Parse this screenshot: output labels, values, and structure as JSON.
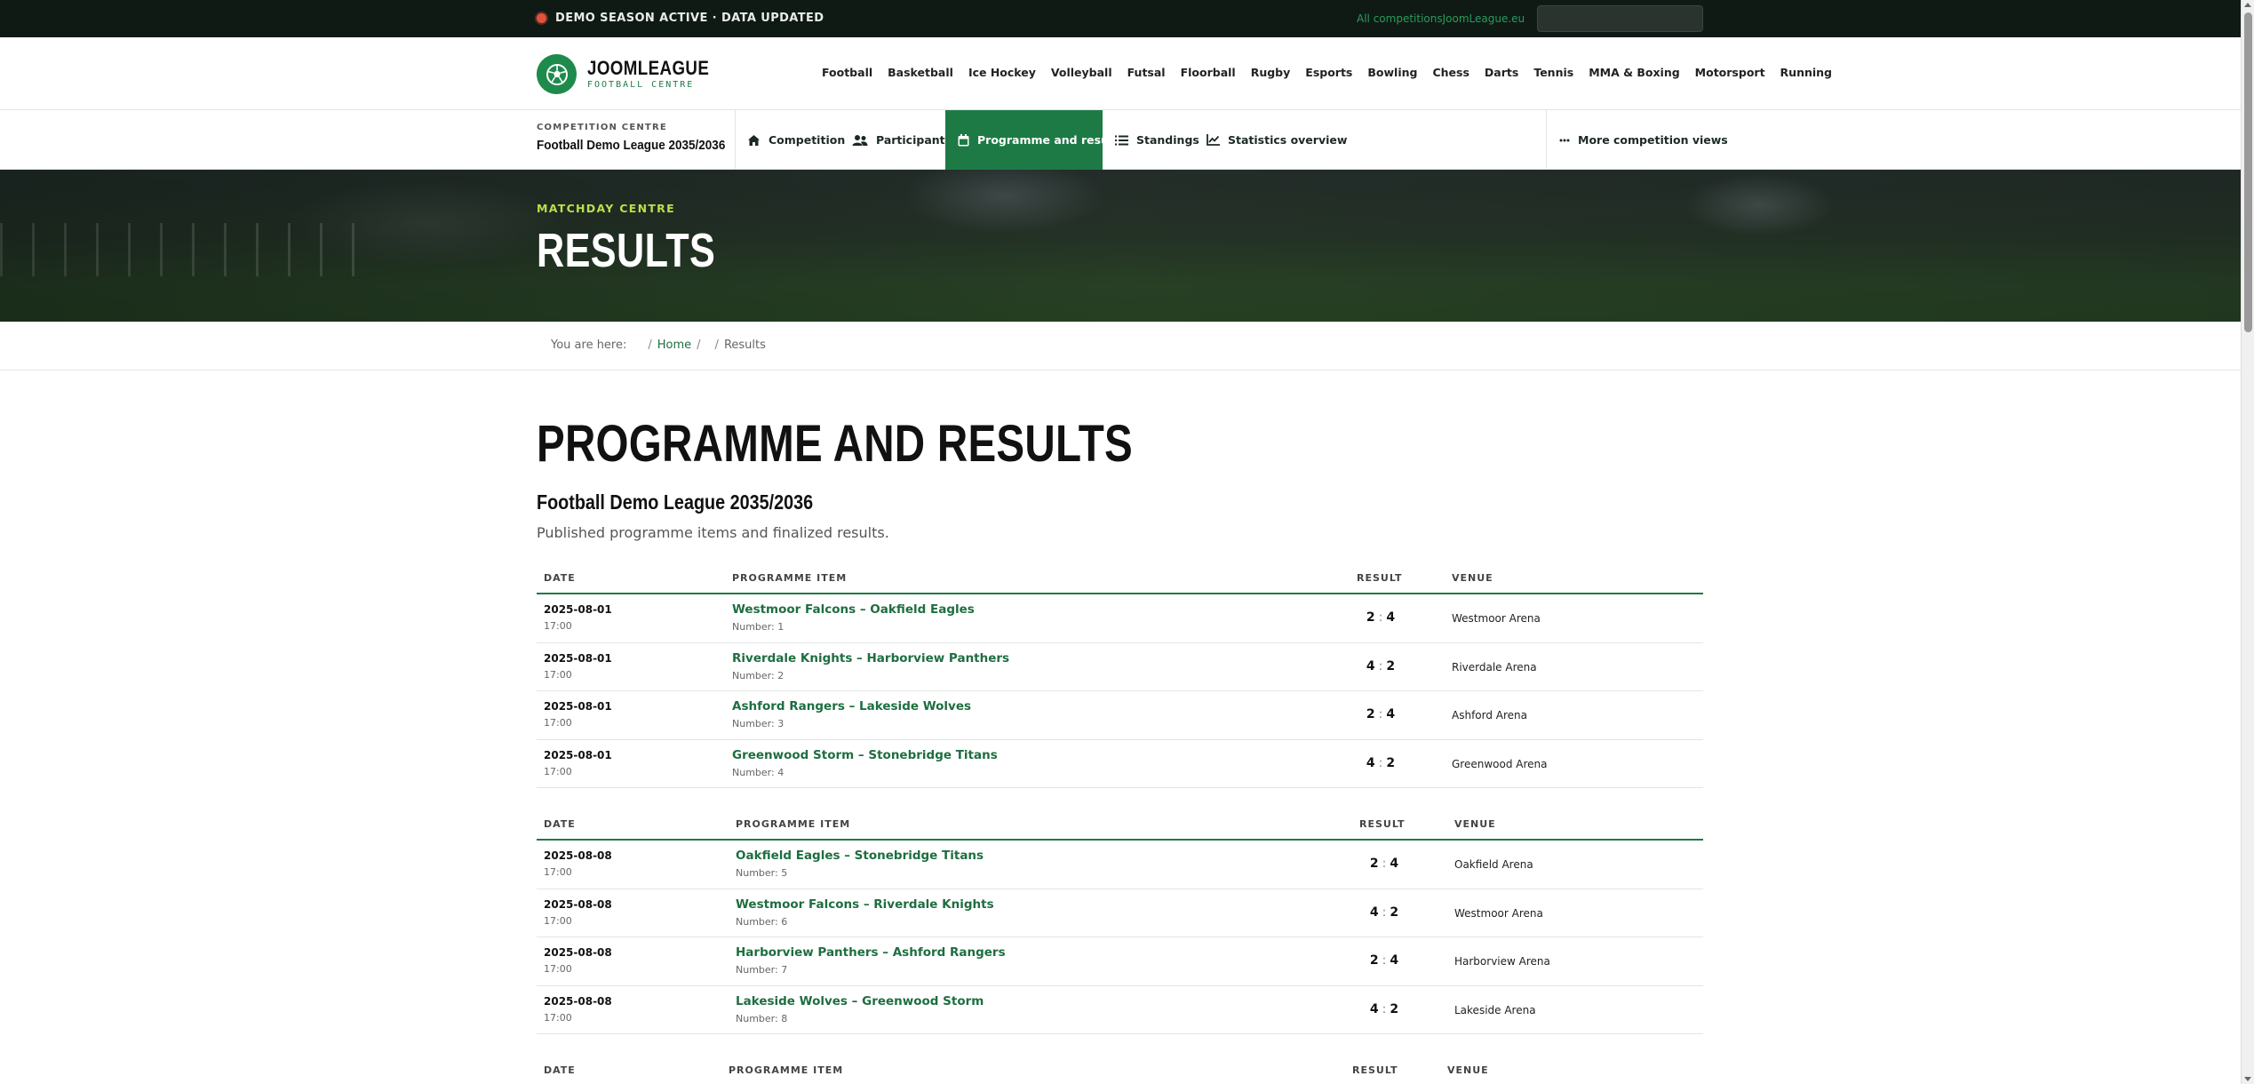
{
  "topbar": {
    "status": "DEMO SEASON ACTIVE · DATA UPDATED",
    "competitions_link": "All competitions",
    "competitions_site": "JoomLeague.eu",
    "status_color": "#e2523a"
  },
  "brand": {
    "name": "JOOMLEAGUE",
    "subtitle": "FOOTBALL CENTRE",
    "accent": "#1e7a45",
    "logo_icon": "soccer-ball-icon"
  },
  "sports": [
    "Football",
    "Basketball",
    "Ice Hockey",
    "Volleyball",
    "Futsal",
    "Floorball",
    "Rugby",
    "Esports",
    "Bowling",
    "Chess",
    "Darts",
    "Tennis",
    "MMA & Boxing",
    "Motorsport",
    "Running"
  ],
  "subnav": {
    "label": "COMPETITION CENTRE",
    "name": "Football Demo League 2035/2036",
    "tabs": [
      {
        "label": "Competition",
        "icon": "home-icon"
      },
      {
        "label": "Participants",
        "icon": "users-icon"
      },
      {
        "label": "Programme and results",
        "icon": "calendar-icon",
        "active": true
      },
      {
        "label": "Standings",
        "icon": "list-icon"
      },
      {
        "label": "Statistics overview",
        "icon": "chart-icon"
      }
    ],
    "more": "More competition views"
  },
  "hero": {
    "kicker": "MATCHDAY CENTRE",
    "title": "RESULTS"
  },
  "breadcrumb": {
    "prefix": "You are here:",
    "home": "Home",
    "current": "Results"
  },
  "main": {
    "title": "PROGRAMME AND RESULTS",
    "league": "Football Demo League 2035/2036",
    "lead": "Published programme items and finalized results."
  },
  "table_headers": {
    "date": "DATE",
    "item": "PROGRAMME ITEM",
    "result": "RESULT",
    "venue": "VENUE"
  },
  "matchdays": [
    {
      "rows": [
        {
          "date": "2025-08-01",
          "time": "17:00",
          "match": "Westmoor Falcons – Oakfield Eagles",
          "number": "Number: 1",
          "home": "2",
          "away": "4",
          "venue": "Westmoor Arena"
        },
        {
          "date": "2025-08-01",
          "time": "17:00",
          "match": "Riverdale Knights – Harborview Panthers",
          "number": "Number: 2",
          "home": "4",
          "away": "2",
          "venue": "Riverdale Arena"
        },
        {
          "date": "2025-08-01",
          "time": "17:00",
          "match": "Ashford Rangers – Lakeside Wolves",
          "number": "Number: 3",
          "home": "2",
          "away": "4",
          "venue": "Ashford Arena"
        },
        {
          "date": "2025-08-01",
          "time": "17:00",
          "match": "Greenwood Storm – Stonebridge Titans",
          "number": "Number: 4",
          "home": "4",
          "away": "2",
          "venue": "Greenwood Arena"
        }
      ]
    },
    {
      "rows": [
        {
          "date": "2025-08-08",
          "time": "17:00",
          "match": "Oakfield Eagles – Stonebridge Titans",
          "number": "Number: 5",
          "home": "2",
          "away": "4",
          "venue": "Oakfield Arena"
        },
        {
          "date": "2025-08-08",
          "time": "17:00",
          "match": "Westmoor Falcons – Riverdale Knights",
          "number": "Number: 6",
          "home": "4",
          "away": "2",
          "venue": "Westmoor Arena"
        },
        {
          "date": "2025-08-08",
          "time": "17:00",
          "match": "Harborview Panthers – Ashford Rangers",
          "number": "Number: 7",
          "home": "2",
          "away": "4",
          "venue": "Harborview Arena"
        },
        {
          "date": "2025-08-08",
          "time": "17:00",
          "match": "Lakeside Wolves – Greenwood Storm",
          "number": "Number: 8",
          "home": "4",
          "away": "2",
          "venue": "Lakeside Arena"
        }
      ]
    },
    {
      "rows": []
    }
  ]
}
